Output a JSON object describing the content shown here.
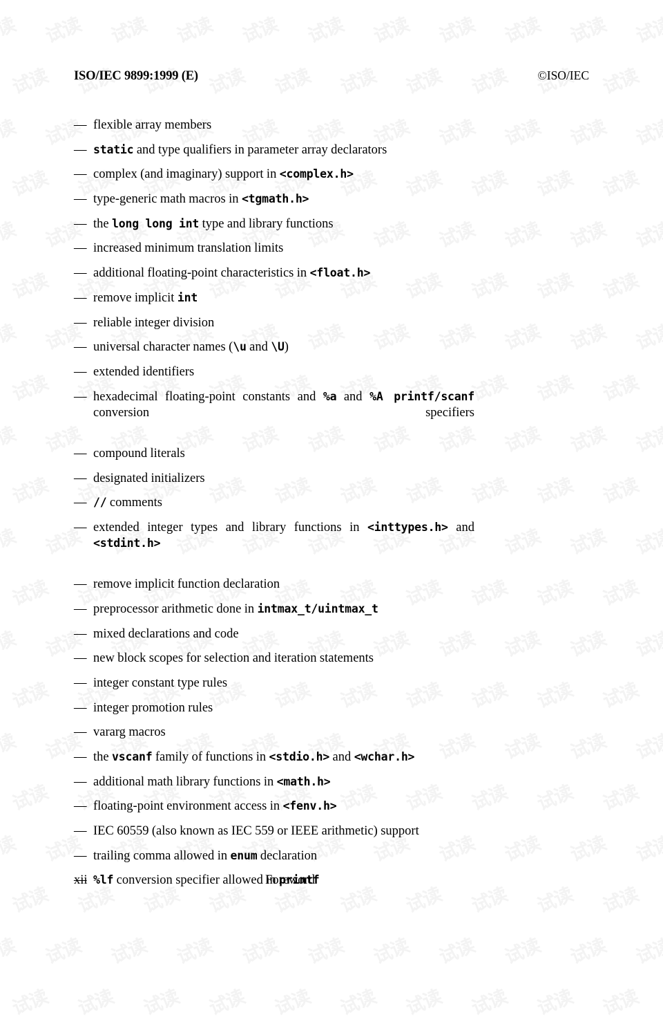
{
  "header": {
    "doc_id": "ISO/IEC 9899:1999 (E)",
    "copyright": "©ISO/IEC"
  },
  "list": {
    "bullet": "—",
    "items": [
      [
        {
          "t": "flexible array members",
          "s": "text"
        }
      ],
      [
        {
          "t": "static",
          "s": "code"
        },
        {
          "t": " and type qualifiers in parameter array declarators",
          "s": "text"
        }
      ],
      [
        {
          "t": "complex (and imaginary) support in ",
          "s": "text"
        },
        {
          "t": "<complex.h>",
          "s": "code"
        }
      ],
      [
        {
          "t": "type-generic math macros in ",
          "s": "text"
        },
        {
          "t": "<tgmath.h>",
          "s": "code"
        }
      ],
      [
        {
          "t": "the ",
          "s": "text"
        },
        {
          "t": "long long int",
          "s": "code"
        },
        {
          "t": " type and library functions",
          "s": "text"
        }
      ],
      [
        {
          "t": "increased minimum translation limits",
          "s": "text"
        }
      ],
      [
        {
          "t": "additional floating-point characteristics in ",
          "s": "text"
        },
        {
          "t": "<float.h>",
          "s": "code"
        }
      ],
      [
        {
          "t": "remove implicit ",
          "s": "text"
        },
        {
          "t": "int",
          "s": "code"
        }
      ],
      [
        {
          "t": "reliable integer division",
          "s": "text"
        }
      ],
      [
        {
          "t": "universal character names (",
          "s": "text"
        },
        {
          "t": "\\u",
          "s": "code"
        },
        {
          "t": " and ",
          "s": "text"
        },
        {
          "t": "\\U",
          "s": "code"
        },
        {
          "t": ")",
          "s": "text"
        }
      ],
      [
        {
          "t": "extended identifiers",
          "s": "text"
        }
      ],
      [
        {
          "t": "hexadecimal floating-point constants and ",
          "s": "text"
        },
        {
          "t": "%a",
          "s": "code"
        },
        {
          "t": " and ",
          "s": "text"
        },
        {
          "t": "%A printf/scanf",
          "s": "code"
        },
        {
          "t": " conversion specifiers",
          "s": "text"
        }
      ],
      [
        {
          "t": "compound literals",
          "s": "text"
        }
      ],
      [
        {
          "t": "designated initializers",
          "s": "text"
        }
      ],
      [
        {
          "t": "//",
          "s": "code"
        },
        {
          "t": " comments",
          "s": "text"
        }
      ],
      [
        {
          "t": "extended integer types and library functions in ",
          "s": "text"
        },
        {
          "t": "<inttypes.h>",
          "s": "code"
        },
        {
          "t": " and ",
          "s": "text"
        },
        {
          "t": "<stdint.h>",
          "s": "code"
        }
      ],
      [
        {
          "t": "remove implicit function declaration",
          "s": "text"
        }
      ],
      [
        {
          "t": "preprocessor arithmetic done in ",
          "s": "text"
        },
        {
          "t": "intmax_t/uintmax_t",
          "s": "code"
        }
      ],
      [
        {
          "t": "mixed declarations and code",
          "s": "text"
        }
      ],
      [
        {
          "t": "new block scopes for selection and iteration statements",
          "s": "text"
        }
      ],
      [
        {
          "t": "integer constant type rules",
          "s": "text"
        }
      ],
      [
        {
          "t": "integer promotion rules",
          "s": "text"
        }
      ],
      [
        {
          "t": "vararg macros",
          "s": "text"
        }
      ],
      [
        {
          "t": "the ",
          "s": "text"
        },
        {
          "t": "vscanf",
          "s": "code"
        },
        {
          "t": " family of functions in ",
          "s": "text"
        },
        {
          "t": "<stdio.h>",
          "s": "code"
        },
        {
          "t": " and ",
          "s": "text"
        },
        {
          "t": "<wchar.h>",
          "s": "code"
        }
      ],
      [
        {
          "t": "additional math library functions in ",
          "s": "text"
        },
        {
          "t": "<math.h>",
          "s": "code"
        }
      ],
      [
        {
          "t": "floating-point environment access in ",
          "s": "text"
        },
        {
          "t": "<fenv.h>",
          "s": "code"
        }
      ],
      [
        {
          "t": "IEC 60559 (also known as IEC 559 or IEEE arithmetic) support",
          "s": "text"
        }
      ],
      [
        {
          "t": "trailing comma allowed in ",
          "s": "text"
        },
        {
          "t": "enum",
          "s": "code"
        },
        {
          "t": " declaration",
          "s": "text"
        }
      ],
      [
        {
          "t": "%lf",
          "s": "code"
        },
        {
          "t": " conversion specifier allowed in ",
          "s": "text"
        },
        {
          "t": "printf",
          "s": "code"
        }
      ]
    ],
    "wrapping_items": [
      11,
      15
    ]
  },
  "footer": {
    "page_number": "xii",
    "section_name": "Foreword"
  },
  "watermark": {
    "text": "试读",
    "color": "#f3f3f3",
    "rows": 21,
    "cols": 13
  }
}
